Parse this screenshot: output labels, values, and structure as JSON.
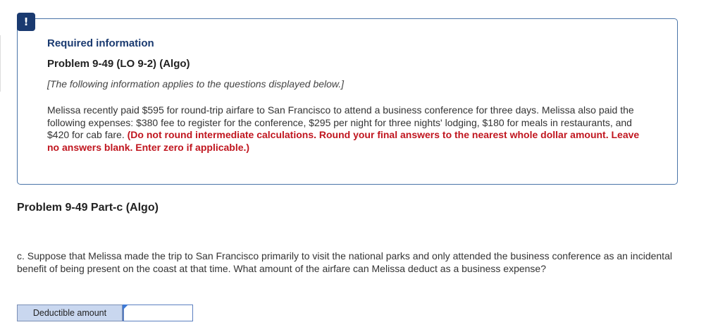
{
  "alert": {
    "icon_name": "exclamation-icon",
    "glyph": "!"
  },
  "info": {
    "required_label": "Required information",
    "problem_title": "Problem 9-49 (LO 9-2) (Algo)",
    "applies_note": "[The following information applies to the questions displayed below.]",
    "scenario_text": "Melissa recently paid $595 for round-trip airfare to San Francisco to attend a business conference for three days. Melissa also paid the following expenses: $380 fee to register for the conference, $295 per night for three nights' lodging, $180 for meals in restaurants, and $420 for cab fare. ",
    "instructions": "(Do not round intermediate calculations. Round your final answers to the nearest whole dollar amount. Leave no answers blank. Enter zero if applicable.)"
  },
  "part": {
    "title": "Problem 9-49 Part-c (Algo)",
    "question": "c. Suppose that Melissa made the trip to San Francisco primarily to visit the national parks and only attended the business conference as an incidental benefit of being present on the coast at that time. What amount of the airfare can Melissa deduct as a business expense?",
    "answer_label": "Deductible amount",
    "answer_value": ""
  },
  "colors": {
    "accent": "#1a3a70",
    "instructions": "#c0161f",
    "box_border": "#4a74a8",
    "label_bg": "#c9d7ef"
  }
}
